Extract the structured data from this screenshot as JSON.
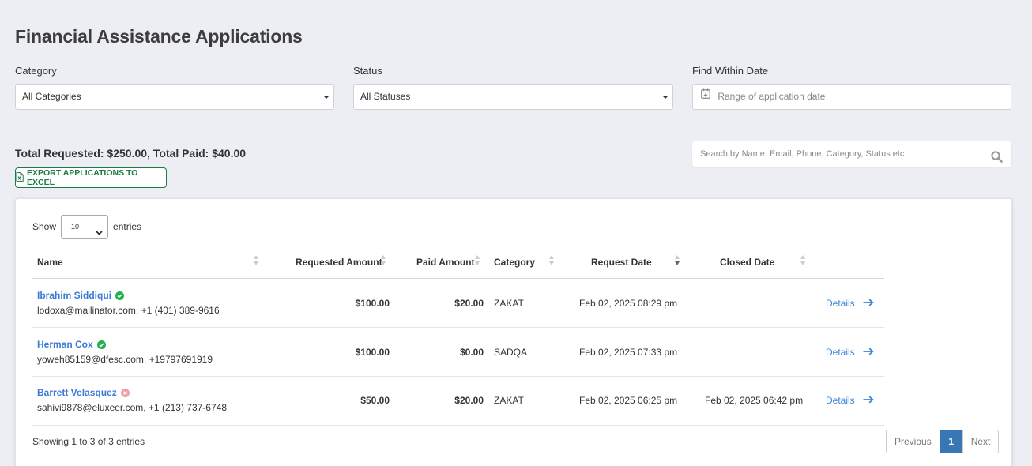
{
  "page": {
    "title": "Financial Assistance Applications"
  },
  "filters": {
    "category": {
      "label": "Category",
      "value": "All Categories"
    },
    "status": {
      "label": "Status",
      "value": "All Statuses"
    },
    "date": {
      "label": "Find Within Date",
      "placeholder": "Range of application date"
    }
  },
  "totals": "Total Requested: $250.00, Total Paid: $40.00",
  "export_label": "EXPORT APPLICATIONS TO EXCEL",
  "search": {
    "placeholder": "Search by Name, Email, Phone, Category, Status etc."
  },
  "table": {
    "show_label": "Show",
    "entries_label": "entries",
    "page_length": "10",
    "columns": {
      "name": "Name",
      "requested": "Requested Amount",
      "paid": "Paid Amount",
      "category": "Category",
      "request_date": "Request Date",
      "closed_date": "Closed Date"
    },
    "rows": [
      {
        "name": "Ibrahim Siddiqui",
        "status_color": "#22b14c",
        "status": "verified",
        "contact": "lodoxa@mailinator.com, +1 (401) 389-9616",
        "requested": "$100.00",
        "paid": "$20.00",
        "category": "ZAKAT",
        "request_date": "Feb 02, 2025 08:29 pm",
        "closed_date": "",
        "details": "Details"
      },
      {
        "name": "Herman Cox",
        "status_color": "#22b14c",
        "status": "verified",
        "contact": "yoweh85159@dfesc.com, +19797691919",
        "requested": "$100.00",
        "paid": "$0.00",
        "category": "SADQA",
        "request_date": "Feb 02, 2025 07:33 pm",
        "closed_date": "",
        "details": "Details"
      },
      {
        "name": "Barrett Velasquez",
        "status_color": "#f0a0a0",
        "status": "rejected",
        "contact": "sahivi9878@eluxeer.com, +1 (213) 737-6748",
        "requested": "$50.00",
        "paid": "$20.00",
        "category": "ZAKAT",
        "request_date": "Feb 02, 2025 06:25 pm",
        "closed_date": "Feb 02, 2025 06:42 pm",
        "details": "Details"
      }
    ],
    "info": "Showing 1 to 3 of 3 entries",
    "pagination": {
      "previous": "Previous",
      "current": "1",
      "next": "Next"
    }
  },
  "colors": {
    "link": "#3a7bd5",
    "export_green": "#1e7a44",
    "page_active": "#3778b4"
  }
}
